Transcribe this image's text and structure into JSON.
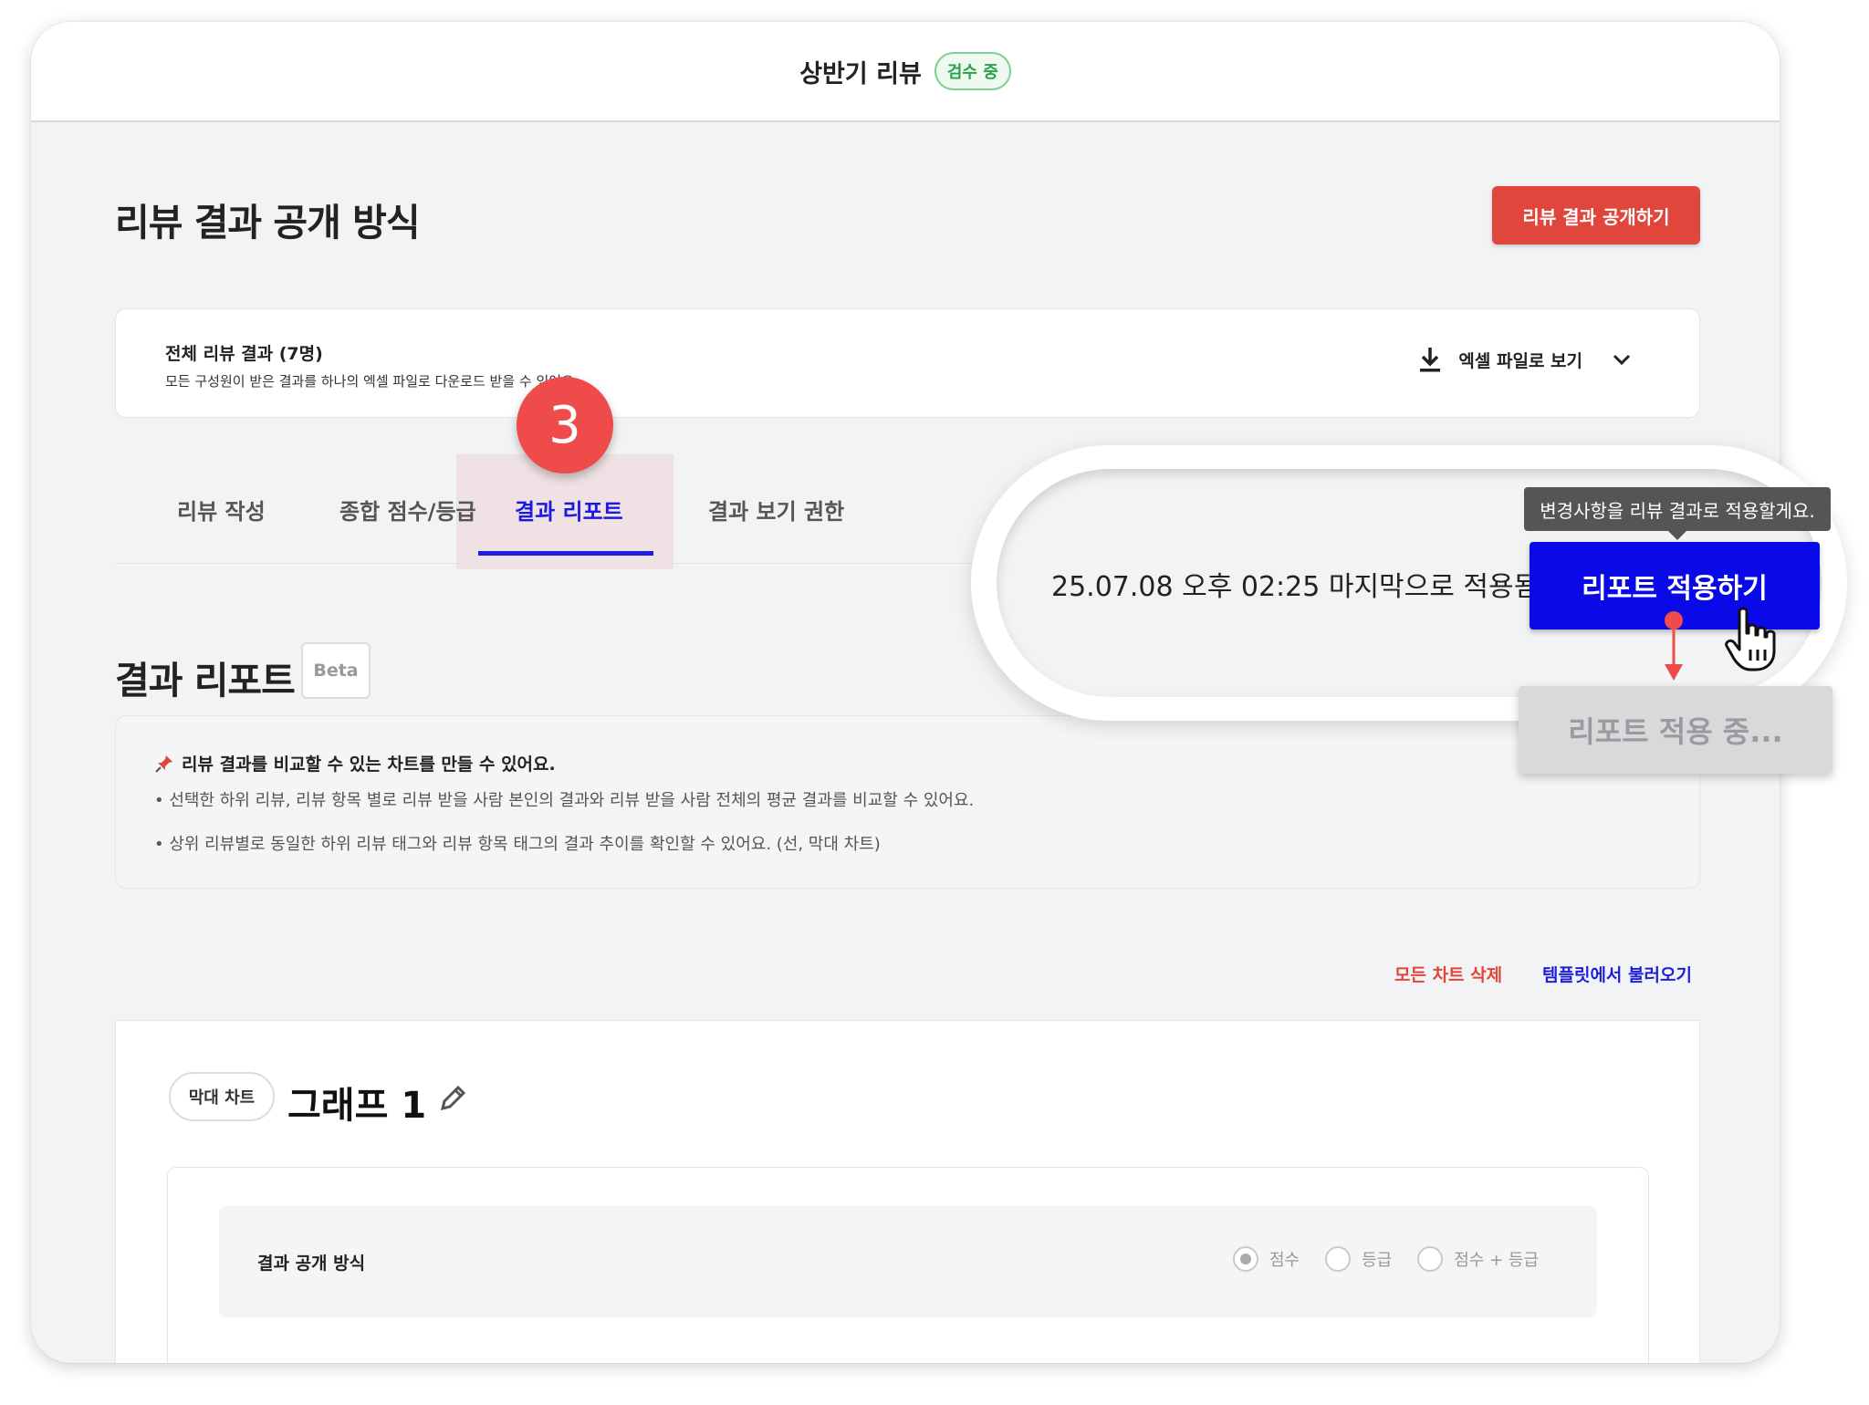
{
  "header": {
    "title": "상반기 리뷰",
    "status_badge": "검수 중"
  },
  "page": {
    "title": "리뷰 결과 공개 방식",
    "publish_button": "리뷰 결과 공개하기"
  },
  "summary": {
    "title": "전체 리뷰 결과 (7명)",
    "description": "모든 구성원이 받은 결과를 하나의 엑셀 파일로 다운로드 받을 수 있어요.",
    "excel_label": "엑셀 파일로 보기"
  },
  "step_badge": "3",
  "tabs": [
    {
      "label": "리뷰 작성"
    },
    {
      "label": "종합 점수/등급"
    },
    {
      "label": "결과 리포트"
    },
    {
      "label": "결과 보기 권한"
    }
  ],
  "section": {
    "title": "결과 리포트",
    "beta": "Beta"
  },
  "info": {
    "headline": "리뷰 결과를 비교할 수 있는 차트를 만들 수 있어요.",
    "bullets": [
      "선택한 하위 리뷰, 리뷰 항목 별로 리뷰 받을 사람 본인의 결과와 리뷰 받을 사람 전체의 평균 결과를 비교할 수 있어요.",
      "상위 리뷰별로 동일한 하위 리뷰 태그와 리뷰 항목 태그의 결과 추이를 확인할 수 있어요. (선, 막대 차트)"
    ]
  },
  "actions": {
    "delete_all": "모든 차트 삭제",
    "load_template": "템플릿에서 불러오기"
  },
  "chart": {
    "type_label": "막대 차트",
    "title": "그래프 1",
    "option_label": "결과 공개 방식",
    "options": [
      "점수",
      "등급",
      "점수 + 등급"
    ],
    "selected_option": "점수"
  },
  "callout": {
    "applied_text": "25.07.08 오후 02:25 마지막으로 적용됨",
    "tooltip": "변경사항을 리뷰 결과로 적용할게요.",
    "apply_button": "리포트 적용하기",
    "applying_button": "리포트 적용 중..."
  },
  "colors": {
    "accent_blue": "#0a0ae8",
    "danger_red": "#e0463c",
    "status_green": "#2aa14a"
  }
}
